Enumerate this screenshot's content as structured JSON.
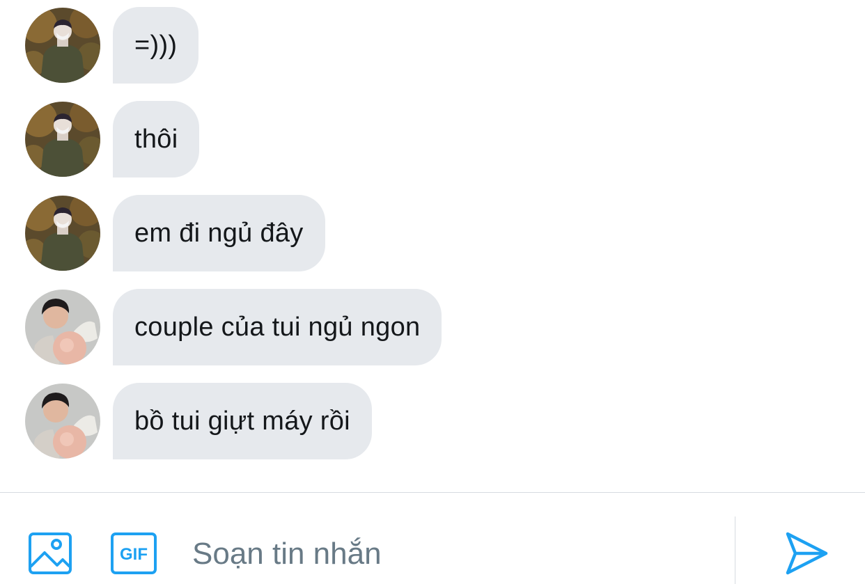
{
  "accent_color": "#1da1f2",
  "bubble_color": "#e6e9ed",
  "messages": [
    {
      "text": "=)))",
      "avatar": "avatar-masked-user"
    },
    {
      "text": "thôi",
      "avatar": "avatar-masked-user"
    },
    {
      "text": "em đi ngủ đây",
      "avatar": "avatar-masked-user"
    },
    {
      "text": "couple của tui ngủ ngon",
      "avatar": "avatar-boy-user"
    },
    {
      "text": "bồ tui giựt máy rồi",
      "avatar": "avatar-boy-user"
    }
  ],
  "composer": {
    "placeholder": "Soạn tin nhắn",
    "value": "",
    "media_icon": "image-icon",
    "gif_icon": "gif-icon",
    "gif_label": "GIF",
    "send_icon": "send-icon"
  }
}
